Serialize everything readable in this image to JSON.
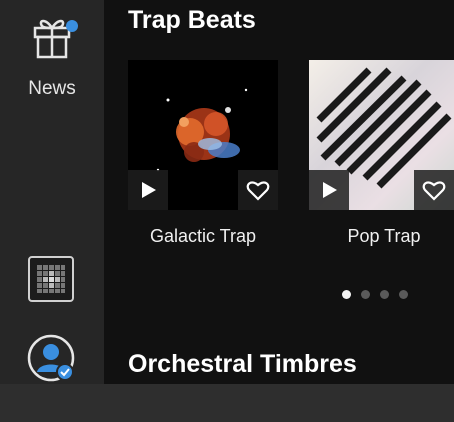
{
  "sidebar": {
    "news_label": "News"
  },
  "sections": {
    "trap_beats": {
      "title": "Trap Beats",
      "cards": [
        {
          "title": "Galactic Trap"
        },
        {
          "title": "Pop Trap"
        }
      ],
      "carousel": {
        "pages": 4,
        "active_page": 1
      }
    },
    "orchestral": {
      "title": "Orchestral Timbres"
    }
  },
  "icons": {
    "news": "gift-icon",
    "grid": "grid-icon",
    "profile": "user-check-icon",
    "play": "play-icon",
    "favorite": "heart-icon"
  },
  "colors": {
    "accent": "#3a8fe0",
    "sidebar_bg": "#262626",
    "content_bg": "#111111"
  }
}
